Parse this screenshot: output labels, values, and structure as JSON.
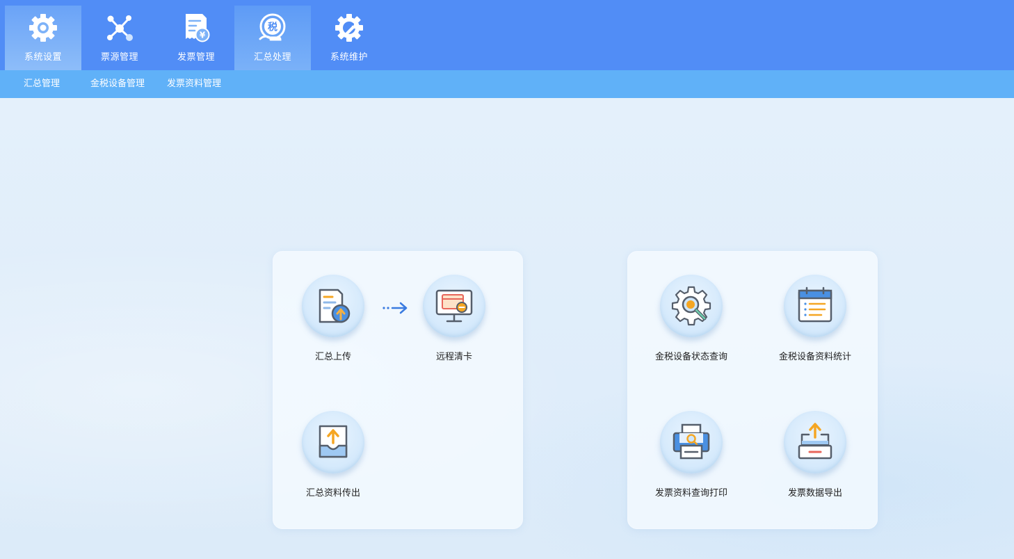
{
  "top_nav": [
    {
      "label": "系统设置",
      "icon": "gear-icon"
    },
    {
      "label": "票源管理",
      "icon": "network-icon"
    },
    {
      "label": "发票管理",
      "icon": "invoice-yen-icon"
    },
    {
      "label": "汇总处理",
      "icon": "tax-icon"
    },
    {
      "label": "系统维护",
      "icon": "wrench-gear-icon"
    }
  ],
  "sub_nav": [
    {
      "label": "汇总管理"
    },
    {
      "label": "金税设备管理"
    },
    {
      "label": "发票资料管理"
    }
  ],
  "panels": [
    {
      "items": [
        {
          "label": "汇总上传",
          "icon": "document-upload-icon"
        },
        {
          "label": "远程清卡",
          "icon": "monitor-card-icon"
        },
        {
          "label": "汇总资料传出",
          "icon": "tray-upload-icon"
        }
      ]
    },
    {
      "items": [
        {
          "label": "金税设备状态查询",
          "icon": "gear-search-icon"
        },
        {
          "label": "金税设备资料统计",
          "icon": "calendar-list-icon"
        },
        {
          "label": "发票资料查询打印",
          "icon": "printer-search-icon"
        },
        {
          "label": "发票数据导出",
          "icon": "export-tray-icon"
        }
      ]
    }
  ],
  "colors": {
    "topbar": "#518df6",
    "subbar": "#60b1f8",
    "background": "#e2effb",
    "accent_blue": "#4a90e2",
    "accent_orange": "#f5a623"
  }
}
